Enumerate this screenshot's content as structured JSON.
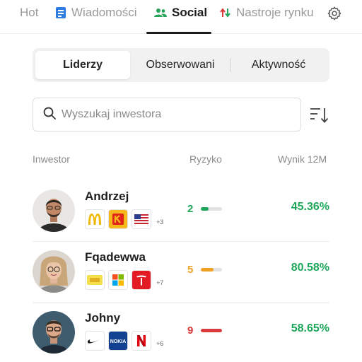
{
  "nav": {
    "tabs": [
      {
        "label": "Hot"
      },
      {
        "label": "Wiadomości"
      },
      {
        "label": "Social"
      },
      {
        "label": "Nastroje rynku"
      }
    ]
  },
  "segments": [
    "Liderzy",
    "Obserwowani",
    "Aktywność"
  ],
  "search": {
    "placeholder": "Wyszukaj inwestora"
  },
  "table": {
    "headers": {
      "investor": "Inwestor",
      "risk": "Ryzyko",
      "result": "Wynik 12M"
    }
  },
  "investors": [
    {
      "name": "Andrzej",
      "holdings": [
        "mcdonalds-logo",
        "kodak-logo",
        "us-flag-logo"
      ],
      "more": "+3",
      "risk": "2",
      "risk_level": 0.35,
      "risk_color": "#1da65a",
      "result": "45.36%"
    },
    {
      "name": "Fqadewwa",
      "holdings": [
        "dax-logo",
        "microsoft-logo",
        "tesla-logo"
      ],
      "more": "+7",
      "risk": "5",
      "risk_level": 0.6,
      "risk_color": "#f0a020",
      "result": "80.58%"
    },
    {
      "name": "Johny",
      "holdings": [
        "nike-logo",
        "nokia-logo",
        "netflix-logo"
      ],
      "more": "+6",
      "risk": "9",
      "risk_level": 1.0,
      "risk_color": "#d93a3a",
      "result": "58.65%"
    }
  ],
  "colors": {
    "accent_green": "#1da65a",
    "social_icon": "#27a35a",
    "news_icon": "#2f7de1"
  }
}
